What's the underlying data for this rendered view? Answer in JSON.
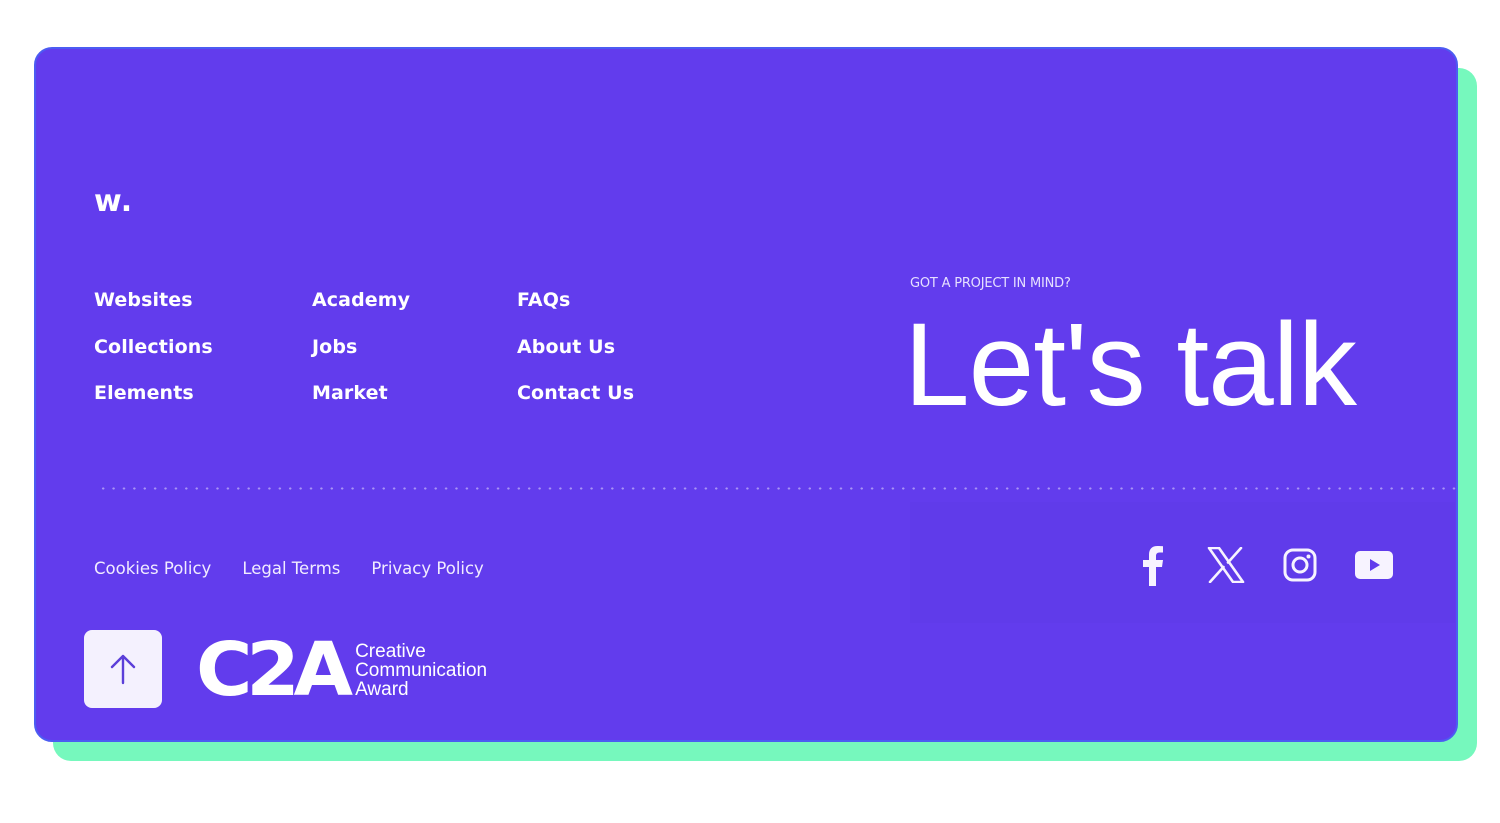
{
  "brand": {
    "logo_text": "w.",
    "primary_color": "#623ced",
    "accent_color": "#76f8bd"
  },
  "nav": {
    "columns": [
      [
        "Websites",
        "Collections",
        "Elements"
      ],
      [
        "Academy",
        "Jobs",
        "Market"
      ],
      [
        "FAQs",
        "About Us",
        "Contact Us"
      ]
    ]
  },
  "cta": {
    "label": "GOT A PROJECT IN MIND?",
    "title": "Let's talk"
  },
  "legal": {
    "links": [
      "Cookies Policy",
      "Legal Terms",
      "Privacy Policy"
    ]
  },
  "social": {
    "icons": [
      "facebook-icon",
      "x-twitter-icon",
      "instagram-icon",
      "youtube-icon"
    ]
  },
  "back_to_top": {
    "icon": "arrow-up-icon"
  },
  "award": {
    "mark": "C2A",
    "lines": [
      "Creative",
      "Communication",
      "Award"
    ]
  }
}
